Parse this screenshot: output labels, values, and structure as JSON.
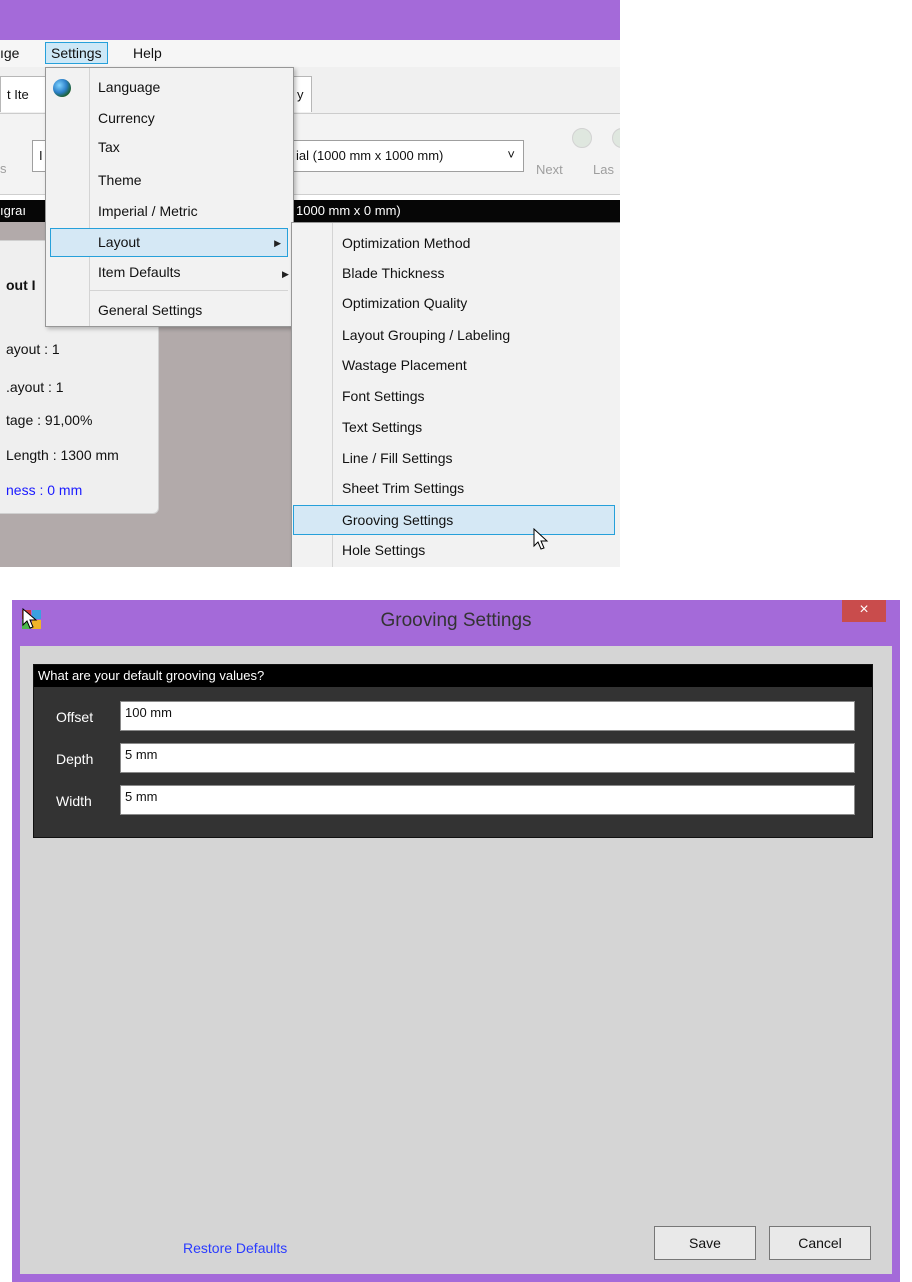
{
  "app": {
    "menubar": [
      {
        "label": "ıge"
      },
      {
        "label": "Settings"
      },
      {
        "label": "Help"
      }
    ],
    "tab_fragment": "t Ite",
    "tab2_fragment": "y",
    "toolbar": {
      "left_fragment": "s",
      "combo_left_fragment": "I",
      "material_combo": "ial (1000 mm x 1000 mm)",
      "combo_arrow": "˅",
      "next_label": "Next",
      "last_fragment": "Las"
    },
    "black_bar": {
      "left_fragment": "ıgraı",
      "right_text": "1000 mm x 0 mm)"
    },
    "info_panel": {
      "title_fragment": "out I",
      "lines": [
        "ayout : 1",
        ".ayout : 1",
        "tage : 91,00%",
        "Length : 1300 mm"
      ],
      "blade_line": "ness : 0 mm",
      "blade_color": "#1a1aff"
    },
    "settings_menu": {
      "items": [
        {
          "label": "Language",
          "icon": "globe-icon"
        },
        {
          "label": "Currency"
        },
        {
          "label": "Tax"
        },
        {
          "label": "Theme"
        },
        {
          "label": "Imperial / Metric"
        },
        {
          "label": "Layout",
          "submenu_arrow": "▶"
        },
        {
          "label": "Item Defaults",
          "submenu_arrow": "▶"
        },
        {
          "label": "General Settings"
        }
      ]
    },
    "layout_submenu": {
      "items": [
        {
          "label": "Optimization Method"
        },
        {
          "label": "Blade Thickness"
        },
        {
          "label": "Optimization Quality"
        },
        {
          "label": "Layout Grouping / Labeling"
        },
        {
          "label": "Wastage Placement"
        },
        {
          "label": "Font Settings"
        },
        {
          "label": "Text Settings"
        },
        {
          "label": "Line / Fill Settings"
        },
        {
          "label": "Sheet Trim Settings"
        },
        {
          "label": "Grooving Settings"
        },
        {
          "label": "Hole Settings"
        }
      ]
    }
  },
  "dialog": {
    "title": "Grooving Settings",
    "close_glyph": "×",
    "group_title": "What are your default grooving values?",
    "fields": [
      {
        "label": "Offset",
        "value": "100 mm"
      },
      {
        "label": "Depth",
        "value": "5 mm"
      },
      {
        "label": "Width",
        "value": "5 mm"
      }
    ],
    "restore_label": "Restore Defaults",
    "save_label": "Save",
    "cancel_label": "Cancel"
  },
  "colors": {
    "title_bar": "#a46ad9",
    "highlight": "#d5e8f5",
    "highlight_border": "#26a0da",
    "close_button": "#c94c4c",
    "link": "#2a3bff"
  }
}
